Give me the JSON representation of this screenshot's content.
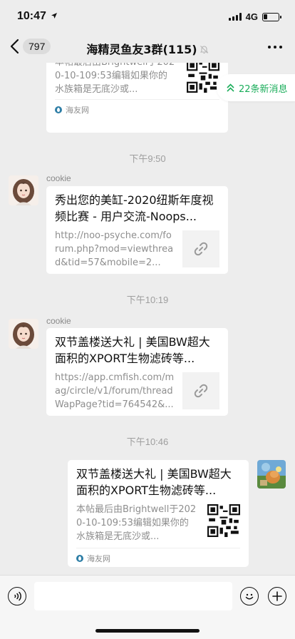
{
  "status_bar": {
    "time": "10:47",
    "network": "4G",
    "battery_level": 0.25
  },
  "header": {
    "unread_count": "797",
    "title": "海精灵鱼友3群(115)"
  },
  "new_messages_pill": {
    "label": "22条新消息"
  },
  "messages": [
    {
      "type": "card",
      "desc": "本帖最后由Brightwell于2020-10-109:53编辑如果你的水族箱是无底沙或...",
      "source": "海友网"
    },
    {
      "type": "time",
      "label": "下午9:50"
    },
    {
      "type": "card",
      "sender": "cookie",
      "title": "秀出您的美缸-2020纽斯年度视频比赛 - 用户交流-Noops...",
      "desc": "http://noo-psyche.com/forum.php?mod=viewthread&tid=57&mobile=2..."
    },
    {
      "type": "time",
      "label": "下午10:19"
    },
    {
      "type": "card",
      "sender": "cookie",
      "title": "双节盖楼送大礼 | 美国BW超大面积的XPORT生物滤砖等...",
      "desc": "https://app.cmfish.com/mag/circle/v1/forum/threadWapPage?tid=764542&..."
    },
    {
      "type": "time",
      "label": "下午10:46"
    },
    {
      "type": "card",
      "sender": "self",
      "title": "双节盖楼送大礼 | 美国BW超大面积的XPORT生物滤砖等...",
      "desc": "本帖最后由Brightwell于2020-10-109:53编辑如果你的水族箱是无底沙或...",
      "source": "海友网"
    }
  ],
  "colors": {
    "accent": "#1aad5a",
    "background": "#ededed"
  }
}
